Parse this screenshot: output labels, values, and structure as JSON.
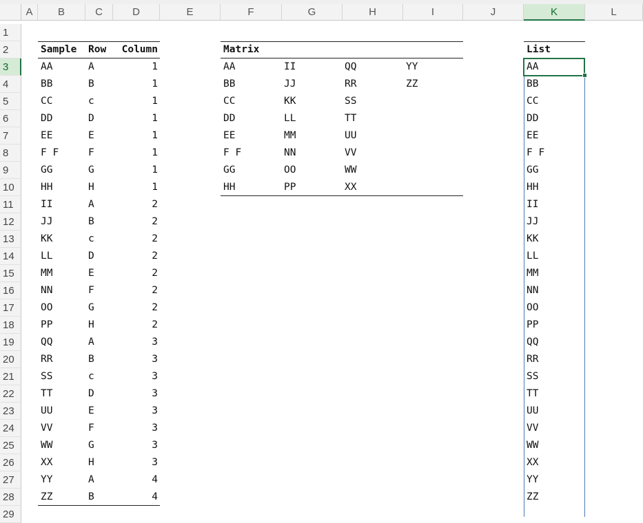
{
  "columns": [
    "A",
    "B",
    "C",
    "D",
    "E",
    "F",
    "G",
    "H",
    "I",
    "J",
    "K",
    "L"
  ],
  "selected_column": "K",
  "rows": [
    "1",
    "2",
    "3",
    "4",
    "5",
    "6",
    "7",
    "8",
    "9",
    "10",
    "11",
    "12",
    "13",
    "14",
    "15",
    "16",
    "17",
    "18",
    "19",
    "20",
    "21",
    "22",
    "23",
    "24",
    "25",
    "26",
    "27",
    "28",
    "29"
  ],
  "selected_row": "3",
  "sample_table": {
    "headers": {
      "sample": "Sample",
      "row": "Row",
      "column": "Column"
    },
    "rows": [
      [
        "AA",
        "A",
        "1"
      ],
      [
        "BB",
        "B",
        "1"
      ],
      [
        "CC",
        "c",
        "1"
      ],
      [
        "DD",
        "D",
        "1"
      ],
      [
        "EE",
        "E",
        "1"
      ],
      [
        "F F",
        "F",
        "1"
      ],
      [
        "GG",
        "G",
        "1"
      ],
      [
        "HH",
        "H",
        "1"
      ],
      [
        "II",
        "A",
        "2"
      ],
      [
        "JJ",
        "B",
        "2"
      ],
      [
        "KK",
        "c",
        "2"
      ],
      [
        "LL",
        "D",
        "2"
      ],
      [
        "MM",
        "E",
        "2"
      ],
      [
        "NN",
        "F",
        "2"
      ],
      [
        "OO",
        "G",
        "2"
      ],
      [
        "PP",
        "H",
        "2"
      ],
      [
        "QQ",
        "A",
        "3"
      ],
      [
        "RR",
        "B",
        "3"
      ],
      [
        "SS",
        "c",
        "3"
      ],
      [
        "TT",
        "D",
        "3"
      ],
      [
        "UU",
        "E",
        "3"
      ],
      [
        "VV",
        "F",
        "3"
      ],
      [
        "WW",
        "G",
        "3"
      ],
      [
        "XX",
        "H",
        "3"
      ],
      [
        "YY",
        "A",
        "4"
      ],
      [
        "ZZ",
        "B",
        "4"
      ]
    ]
  },
  "matrix": {
    "header": "Matrix",
    "rows": [
      [
        "AA",
        "II",
        "QQ",
        "YY"
      ],
      [
        "BB",
        "JJ",
        "RR",
        "ZZ"
      ],
      [
        "CC",
        "KK",
        "SS",
        ""
      ],
      [
        "DD",
        "LL",
        "TT",
        ""
      ],
      [
        "EE",
        "MM",
        "UU",
        ""
      ],
      [
        "F F",
        "NN",
        "VV",
        ""
      ],
      [
        "GG",
        "OO",
        "WW",
        ""
      ],
      [
        "HH",
        "PP",
        "XX",
        ""
      ]
    ]
  },
  "list": {
    "header": "List",
    "items": [
      "AA",
      "BB",
      "CC",
      "DD",
      "EE",
      "F F",
      "GG",
      "HH",
      "II",
      "JJ",
      "KK",
      "LL",
      "MM",
      "NN",
      "OO",
      "PP",
      "QQ",
      "RR",
      "SS",
      "TT",
      "UU",
      "VV",
      "WW",
      "XX",
      "YY",
      "ZZ"
    ]
  }
}
